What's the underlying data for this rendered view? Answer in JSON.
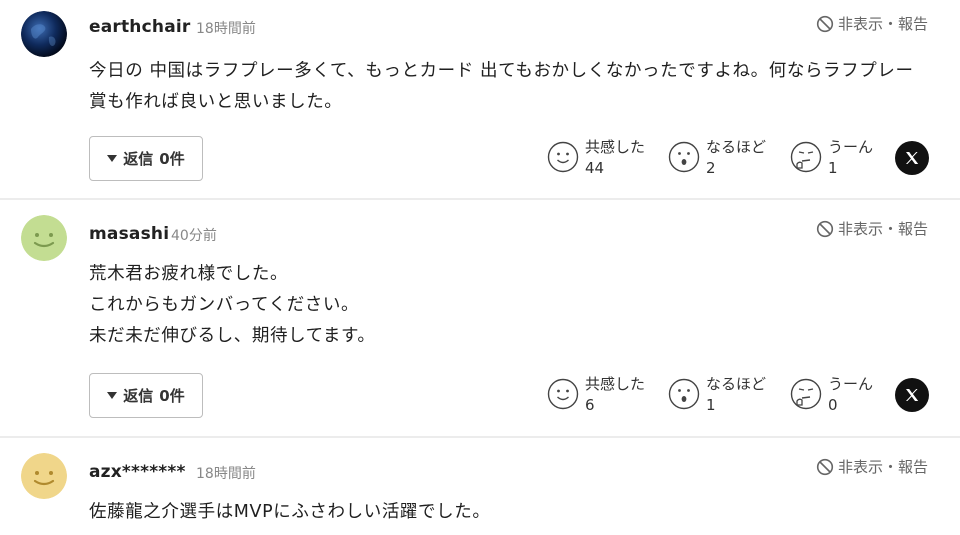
{
  "report_label": "非表示・報告",
  "reply_label": "返信",
  "reaction_labels": [
    "共感した",
    "なるほど",
    "うーん"
  ],
  "comments": [
    {
      "username": "earthchair",
      "time": "18時間前",
      "avatar": "earth-avatar",
      "lines": [
        "今日の 中国はラフプレー多くて、もっとカード 出てもおかしくなかったですよね。何ならラフプレー",
        "賞も作れば良いと思いました。"
      ],
      "reply_count": "0件",
      "counts": [
        "44",
        "2",
        "1"
      ]
    },
    {
      "username": "masashi",
      "time": "40分前",
      "avatar": "smiley-green-avatar",
      "lines": [
        "荒木君お疲れ様でした。",
        "これからもガンバってください。",
        "未だ未だ伸びるし、期待してます。"
      ],
      "reply_count": "0件",
      "counts": [
        "6",
        "1",
        "0"
      ]
    },
    {
      "username": "azx*******",
      "time": "18時間前",
      "avatar": "smiley-yellow-avatar",
      "lines": [
        "佐藤龍之介選手はMVPにふさわしい活躍でした。"
      ]
    }
  ]
}
